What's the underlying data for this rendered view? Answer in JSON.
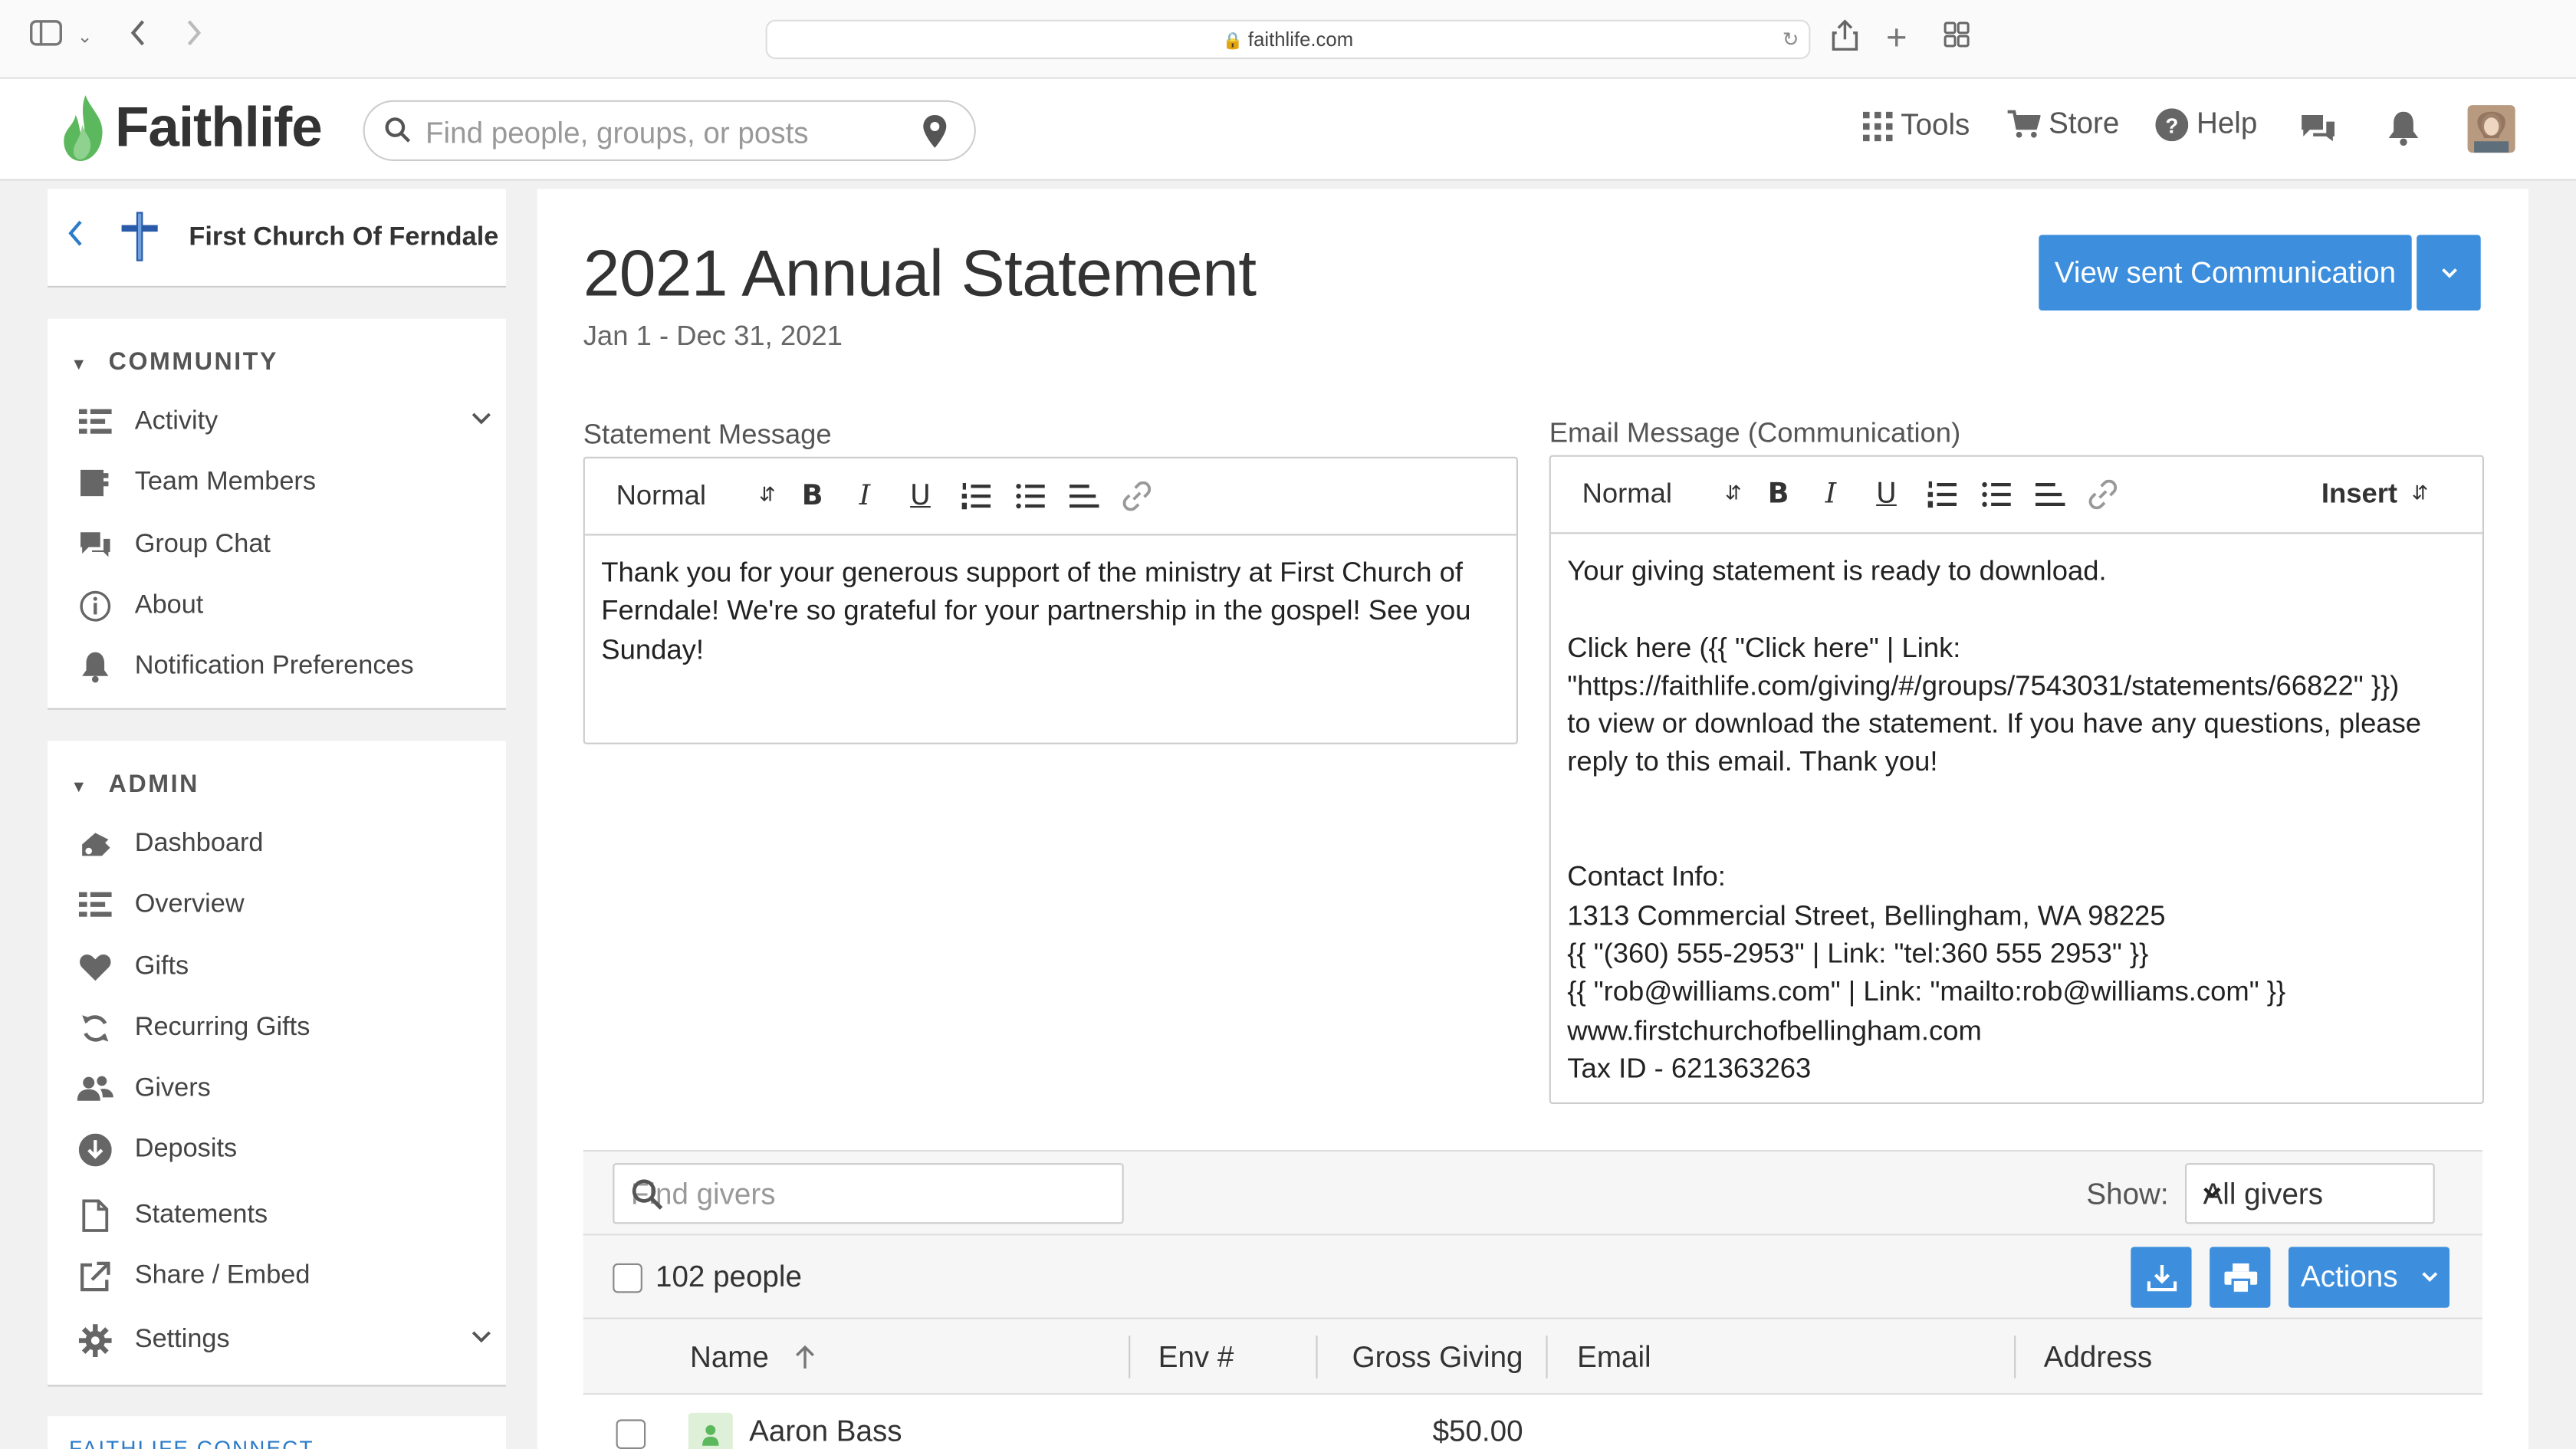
{
  "browser": {
    "url": "faithlife.com"
  },
  "header": {
    "brand": "Faithlife",
    "search_placeholder": "Find people, groups, or posts",
    "nav": {
      "tools": "Tools",
      "store": "Store",
      "help": "Help"
    }
  },
  "sidebar": {
    "group_name": "First Church Of Ferndale",
    "community": {
      "heading": "COMMUNITY",
      "items": [
        {
          "label": "Activity",
          "icon": "list-icon"
        },
        {
          "label": "Team Members",
          "icon": "roster-icon"
        },
        {
          "label": "Group Chat",
          "icon": "chat-bubbles-icon"
        },
        {
          "label": "About",
          "icon": "info-icon"
        },
        {
          "label": "Notification Preferences",
          "icon": "bell-icon"
        }
      ]
    },
    "admin": {
      "heading": "ADMIN",
      "items": [
        {
          "label": "Dashboard",
          "icon": "dashboard-icon"
        },
        {
          "label": "Overview",
          "icon": "list-icon"
        },
        {
          "label": "Gifts",
          "icon": "heart-icon"
        },
        {
          "label": "Recurring Gifts",
          "icon": "recurring-icon"
        },
        {
          "label": "Givers",
          "icon": "people-icon"
        },
        {
          "label": "Deposits",
          "icon": "deposit-icon"
        },
        {
          "label": "Statements",
          "icon": "document-icon"
        },
        {
          "label": "Share / Embed",
          "icon": "share-icon"
        },
        {
          "label": "Settings",
          "icon": "gear-icon"
        }
      ]
    },
    "connect_heading": "FAITHLIFE CONNECT"
  },
  "main": {
    "title": "2021 Annual Statement",
    "date_range": "Jan 1 - Dec 31, 2021",
    "view_sent_button": "View sent Communication",
    "statement_editor": {
      "label": "Statement Message",
      "format": "Normal",
      "content": "Thank you for your generous support of the ministry at First Church of\nFerndale! We're so grateful for your partnership in the gospel! See you\nSunday!"
    },
    "email_editor": {
      "label": "Email Message (Communication)",
      "format": "Normal",
      "insert": "Insert",
      "content": "Your giving statement is ready to download.\n\nClick here ({{ \"Click here\" | Link:\n\"https://faithlife.com/giving/#/groups/7543031/statements/66822\" }})\nto view or download the statement. If you have any questions, please\nreply to this email. Thank you!\n\n\nContact Info:\n1313 Commercial Street, Bellingham, WA 98225\n{{ \"(360) 555-2953\" | Link: \"tel:360 555 2953\" }}\n{{ \"rob@williams.com\" | Link: \"mailto:rob@williams.com\" }}\nwww.firstchurchofbellingham.com\nTax ID - 621363263"
    },
    "givers": {
      "search_placeholder": "Find givers",
      "show_label": "Show:",
      "show_value": "All givers",
      "count": "102 people",
      "actions_label": "Actions",
      "columns": [
        "Name",
        "Env #",
        "Gross Giving",
        "Email",
        "Address"
      ],
      "rows": [
        {
          "name": "Aaron Bass",
          "env": "",
          "gross": "$50.00",
          "email": "",
          "address": ""
        }
      ]
    }
  },
  "colors": {
    "accent": "#3d8fde",
    "brand_green": "#5cb85c"
  }
}
